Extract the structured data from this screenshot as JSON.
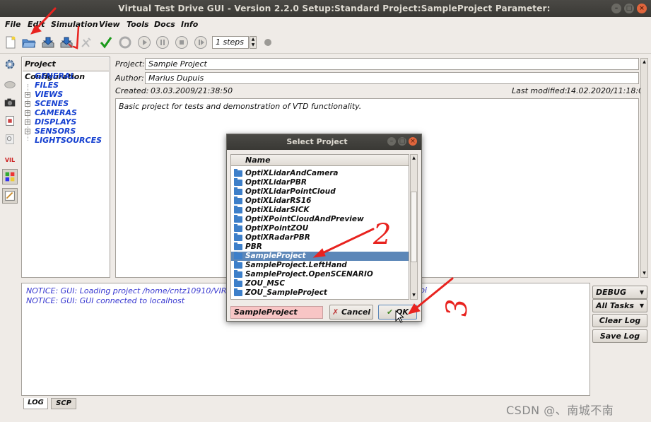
{
  "window": {
    "title": "Virtual Test Drive GUI - Version 2.2.0    Setup:Standard    Project:SampleProject    Parameter:"
  },
  "menu": [
    "File",
    "Edit",
    "Simulation",
    "View",
    "Tools",
    "Docs",
    "Info"
  ],
  "toolbar": {
    "steps_value": "1 steps"
  },
  "sidebar": {
    "vil_label": "VIL"
  },
  "tree": {
    "header": "Project Configuration",
    "items": [
      "GENERAL",
      "FILES",
      "VIEWS",
      "SCENES",
      "CAMERAS",
      "DISPLAYS",
      "SENSORS",
      "LIGHTSOURCES"
    ]
  },
  "project": {
    "project_label": "Project:",
    "project_value": "Sample Project",
    "author_label": "Author:",
    "author_value": "Marius Dupuis",
    "created_label": "Created:",
    "created_value": "03.03.2009/21:38:50",
    "modified_label": "Last modified:",
    "modified_value": "14.02.2020/11:18:04",
    "description": "Basic project for tests and demonstration of VTD functionality."
  },
  "log": {
    "lines": [
      "NOTICE:  GUI: Loading project /home/cntz10910/VIRES/",
      "NOTICE:  GUI: GUI connected to localhost"
    ],
    "line1_tail": "pi",
    "level": "DEBUG",
    "tasks": "All Tasks",
    "clear": "Clear Log",
    "save": "Save Log",
    "tabs": [
      "LOG",
      "SCP"
    ]
  },
  "dialog": {
    "title": "Select Project",
    "column": "Name",
    "items": [
      "OptiXLidarAndCamera",
      "OptiXLidarPBR",
      "OptiXLidarPointCloud",
      "OptiXLidarRS16",
      "OptiXLidarSICK",
      "OptiXPointCloudAndPreview",
      "OptiXPointZOU",
      "OptiXRadarPBR",
      "PBR",
      "SampleProject",
      "SampleProject.LeftHand",
      "SampleProject.OpenSCENARIO",
      "ZOU_MSC",
      "ZOU_SampleProject"
    ],
    "selected": "SampleProject",
    "input_value": "SampleProject",
    "cancel": "Cancel",
    "ok": "OK"
  },
  "annotations": {
    "two": "2",
    "three": "3"
  },
  "watermark": "CSDN @、南城不南",
  "colors": {
    "tree_text": "#1540d0",
    "log_text": "#3838d0",
    "selection": "#5c87b8",
    "input_bg": "#f8c5c5",
    "arrow": "#e8231f",
    "close": "#e0653c"
  }
}
